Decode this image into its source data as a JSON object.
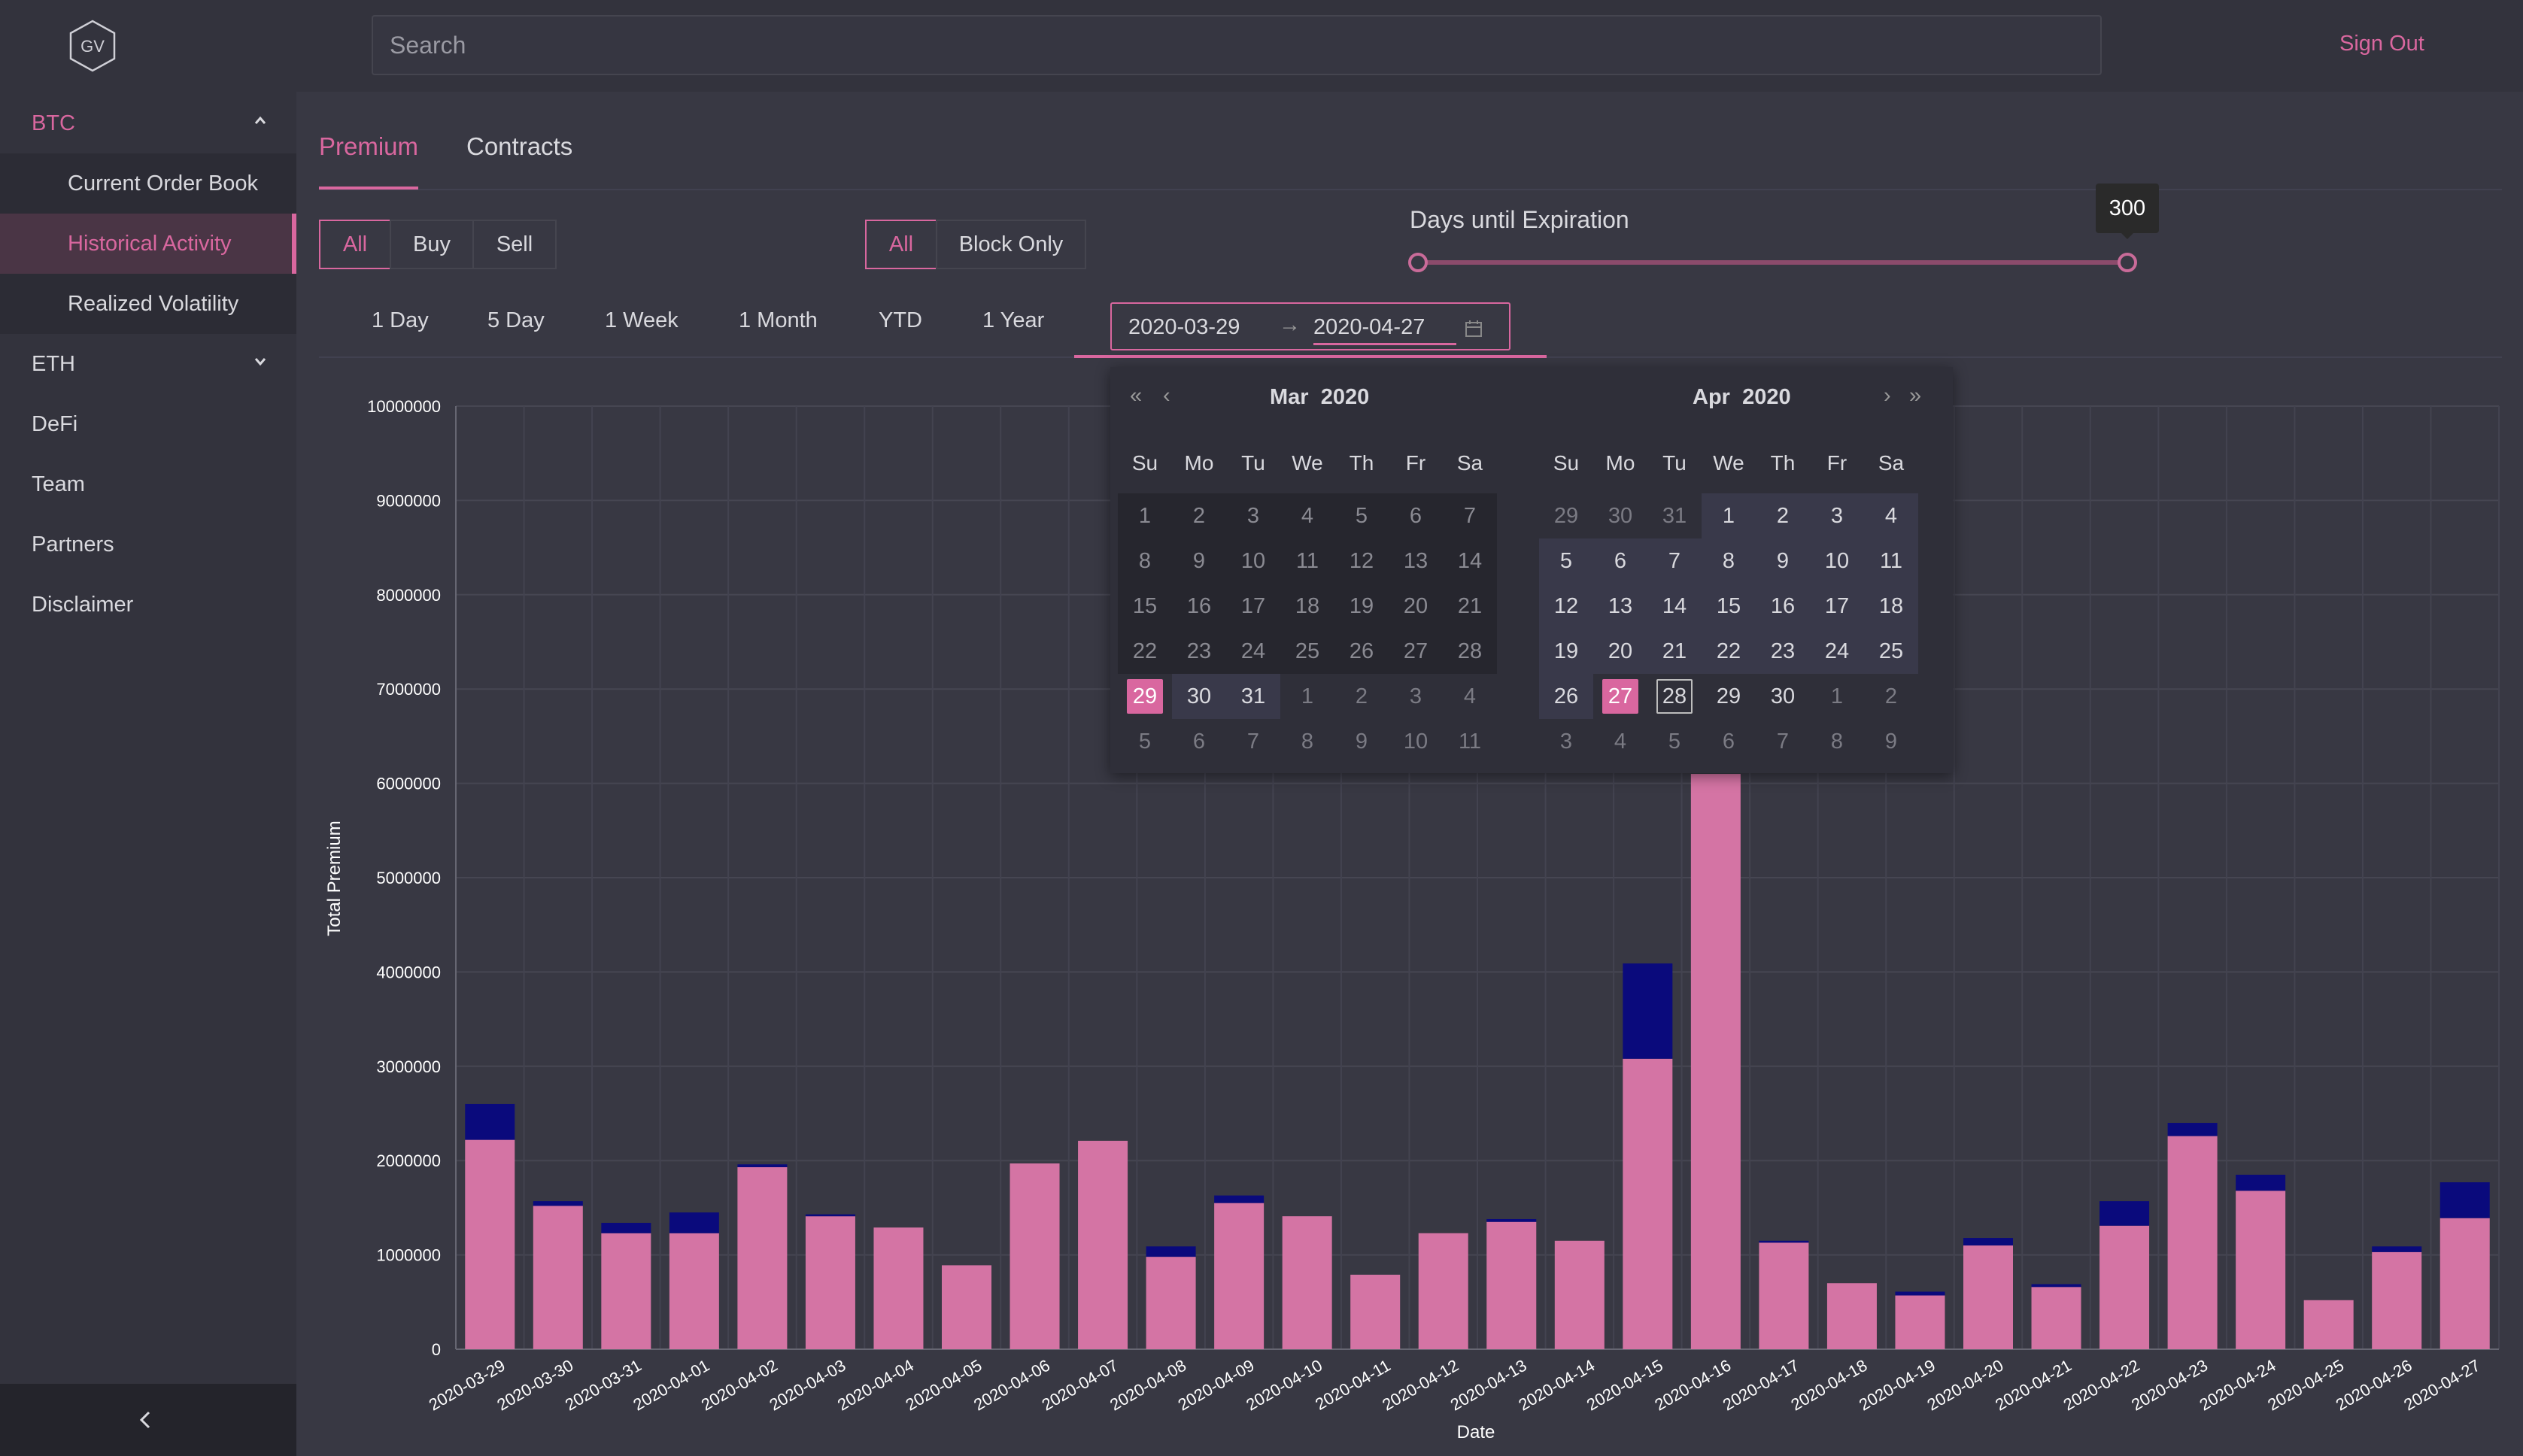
{
  "brand": {
    "logo_text": "GV"
  },
  "search": {
    "placeholder": "Search"
  },
  "header": {
    "sign_out": "Sign Out"
  },
  "sidebar": {
    "btc": {
      "label": "BTC",
      "items": [
        {
          "label": "Current Order Book"
        },
        {
          "label": "Historical Activity",
          "active": true
        },
        {
          "label": "Realized Volatility"
        }
      ]
    },
    "eth": {
      "label": "ETH"
    },
    "items": [
      {
        "label": "DeFi"
      },
      {
        "label": "Team"
      },
      {
        "label": "Partners"
      },
      {
        "label": "Disclaimer"
      }
    ],
    "collapse_icon": "chevron-left-icon"
  },
  "tabs": [
    {
      "label": "Premium",
      "active": true
    },
    {
      "label": "Contracts"
    }
  ],
  "side_filter": [
    {
      "label": "All",
      "selected": true
    },
    {
      "label": "Buy"
    },
    {
      "label": "Sell"
    }
  ],
  "block_filter": [
    {
      "label": "All",
      "selected": true
    },
    {
      "label": "Block Only"
    }
  ],
  "slider": {
    "label": "Days until Expiration",
    "value": "300",
    "range": "0-300",
    "fraction": 1.0
  },
  "ranges": [
    "1 Day",
    "5 Day",
    "1 Week",
    "1 Month",
    "YTD",
    "1 Year"
  ],
  "date_range": {
    "start": "2020-03-29",
    "end": "2020-04-27",
    "arrow": "→"
  },
  "calendar": {
    "dow": [
      "Su",
      "Mo",
      "Tu",
      "We",
      "Th",
      "Fr",
      "Sa"
    ],
    "left": {
      "month": "Mar",
      "year": "2020",
      "days": [
        [
          "1",
          "2",
          "3",
          "4",
          "5",
          "6",
          "7"
        ],
        [
          "8",
          "9",
          "10",
          "11",
          "12",
          "13",
          "14"
        ],
        [
          "15",
          "16",
          "17",
          "18",
          "19",
          "20",
          "21"
        ],
        [
          "22",
          "23",
          "24",
          "25",
          "26",
          "27",
          "28"
        ],
        [
          "29",
          "30",
          "31",
          "1",
          "2",
          "3",
          "4"
        ],
        [
          "5",
          "6",
          "7",
          "8",
          "9",
          "10",
          "11"
        ]
      ]
    },
    "right": {
      "month": "Apr",
      "year": "2020",
      "days": [
        [
          "29",
          "30",
          "31",
          "1",
          "2",
          "3",
          "4"
        ],
        [
          "5",
          "6",
          "7",
          "8",
          "9",
          "10",
          "11"
        ],
        [
          "12",
          "13",
          "14",
          "15",
          "16",
          "17",
          "18"
        ],
        [
          "19",
          "20",
          "21",
          "22",
          "23",
          "24",
          "25"
        ],
        [
          "26",
          "27",
          "28",
          "29",
          "30",
          "1",
          "2"
        ],
        [
          "3",
          "4",
          "5",
          "6",
          "7",
          "8",
          "9"
        ]
      ]
    }
  },
  "chart_data": {
    "type": "bar",
    "stacked": true,
    "xlabel": "Date",
    "ylabel": "Total Premium",
    "ylim": [
      0,
      10000000
    ],
    "yticks": [
      "0",
      "1000000",
      "2000000",
      "3000000",
      "4000000",
      "5000000",
      "6000000",
      "7000000",
      "8000000",
      "9000000",
      "10000000"
    ],
    "categories": [
      "2020-03-29",
      "2020-03-30",
      "2020-03-31",
      "2020-04-01",
      "2020-04-02",
      "2020-04-03",
      "2020-04-04",
      "2020-04-05",
      "2020-04-06",
      "2020-04-07",
      "2020-04-08",
      "2020-04-09",
      "2020-04-10",
      "2020-04-11",
      "2020-04-12",
      "2020-04-13",
      "2020-04-14",
      "2020-04-15",
      "2020-04-16",
      "2020-04-17",
      "2020-04-18",
      "2020-04-19",
      "2020-04-20",
      "2020-04-21",
      "2020-04-22",
      "2020-04-23",
      "2020-04-24",
      "2020-04-25",
      "2020-04-26",
      "2020-04-27"
    ],
    "series": [
      {
        "color": "#d474a4",
        "values": [
          2220000,
          1520000,
          1230000,
          1230000,
          1930000,
          1410000,
          1290000,
          890000,
          1970000,
          2210000,
          980000,
          1550000,
          1410000,
          790000,
          1230000,
          1350000,
          1150000,
          3080000,
          6100000,
          1130000,
          700000,
          570000,
          1100000,
          660000,
          1310000,
          2260000,
          1680000,
          520000,
          1030000,
          1390000
        ]
      },
      {
        "color": "#0a0a7c",
        "values": [
          380000,
          50000,
          110000,
          220000,
          30000,
          20000,
          0,
          0,
          0,
          0,
          110000,
          80000,
          0,
          0,
          0,
          30000,
          0,
          1010000,
          0,
          20000,
          0,
          40000,
          80000,
          30000,
          260000,
          140000,
          170000,
          0,
          60000,
          380000
        ]
      }
    ]
  }
}
